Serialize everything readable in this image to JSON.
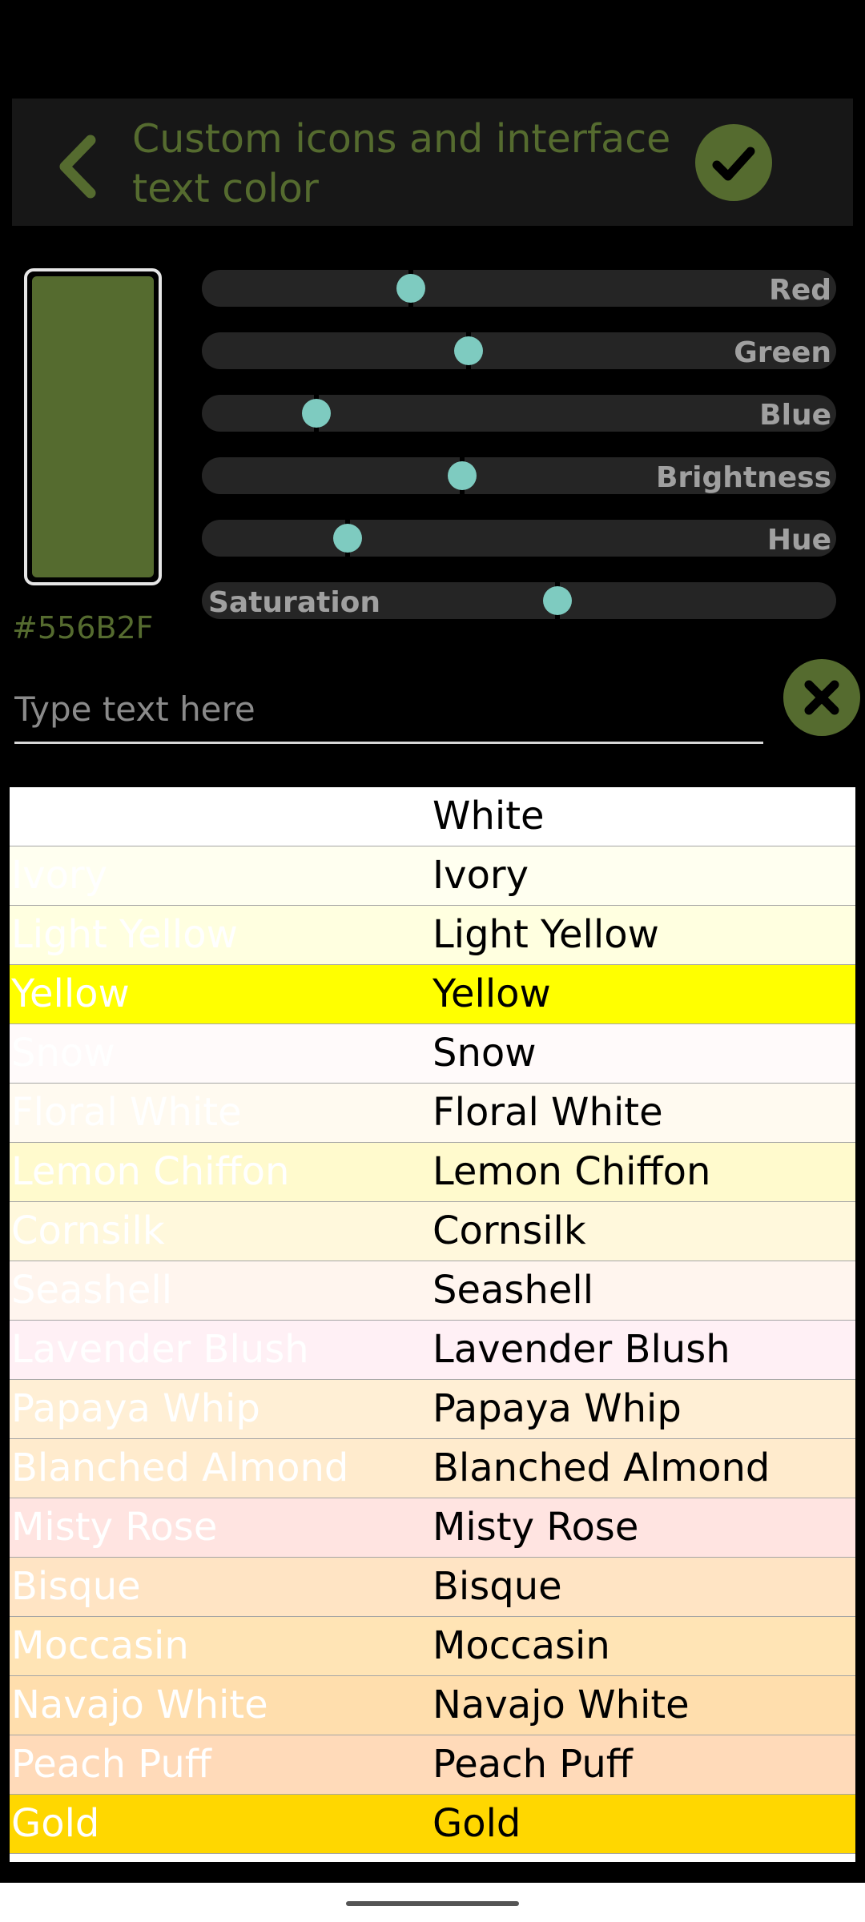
{
  "header": {
    "title": "Custom icons and interface text color",
    "back_icon": "chevron-left-icon",
    "confirm_icon": "check-icon"
  },
  "colors": {
    "accent": "#556b2f",
    "thumb": "#7ecbc0",
    "track": "#252525"
  },
  "preview": {
    "hex": "#556B2F",
    "color": "#556b2f"
  },
  "sliders": [
    {
      "label": "Red",
      "value": 0.33
    },
    {
      "label": "Green",
      "value": 0.42
    },
    {
      "label": "Blue",
      "value": 0.18
    },
    {
      "label": "Brightness",
      "value": 0.41
    },
    {
      "label": "Hue",
      "value": 0.23
    },
    {
      "label": "Saturation",
      "value": 0.56
    }
  ],
  "search": {
    "placeholder": "Type text here",
    "value": "",
    "clear_icon": "close-icon"
  },
  "colors_list": [
    {
      "name": "White",
      "color": "#ffffff"
    },
    {
      "name": "Ivory",
      "color": "#fffff0"
    },
    {
      "name": "Light Yellow",
      "color": "#ffffe0"
    },
    {
      "name": "Yellow",
      "color": "#ffff00"
    },
    {
      "name": "Snow",
      "color": "#fffafa"
    },
    {
      "name": "Floral White",
      "color": "#fffaf0"
    },
    {
      "name": "Lemon Chiffon",
      "color": "#fffacd"
    },
    {
      "name": "Cornsilk",
      "color": "#fff8dc"
    },
    {
      "name": "Seashell",
      "color": "#fff5ee"
    },
    {
      "name": "Lavender Blush",
      "color": "#fff0f5"
    },
    {
      "name": "Papaya Whip",
      "color": "#ffefd5"
    },
    {
      "name": "Blanched Almond",
      "color": "#ffebcd"
    },
    {
      "name": "Misty Rose",
      "color": "#ffe4e1"
    },
    {
      "name": "Bisque",
      "color": "#ffe4c4"
    },
    {
      "name": "Moccasin",
      "color": "#ffe4b5"
    },
    {
      "name": "Navajo White",
      "color": "#ffdead"
    },
    {
      "name": "Peach Puff",
      "color": "#ffdab9"
    },
    {
      "name": "Gold",
      "color": "#ffd700"
    }
  ]
}
